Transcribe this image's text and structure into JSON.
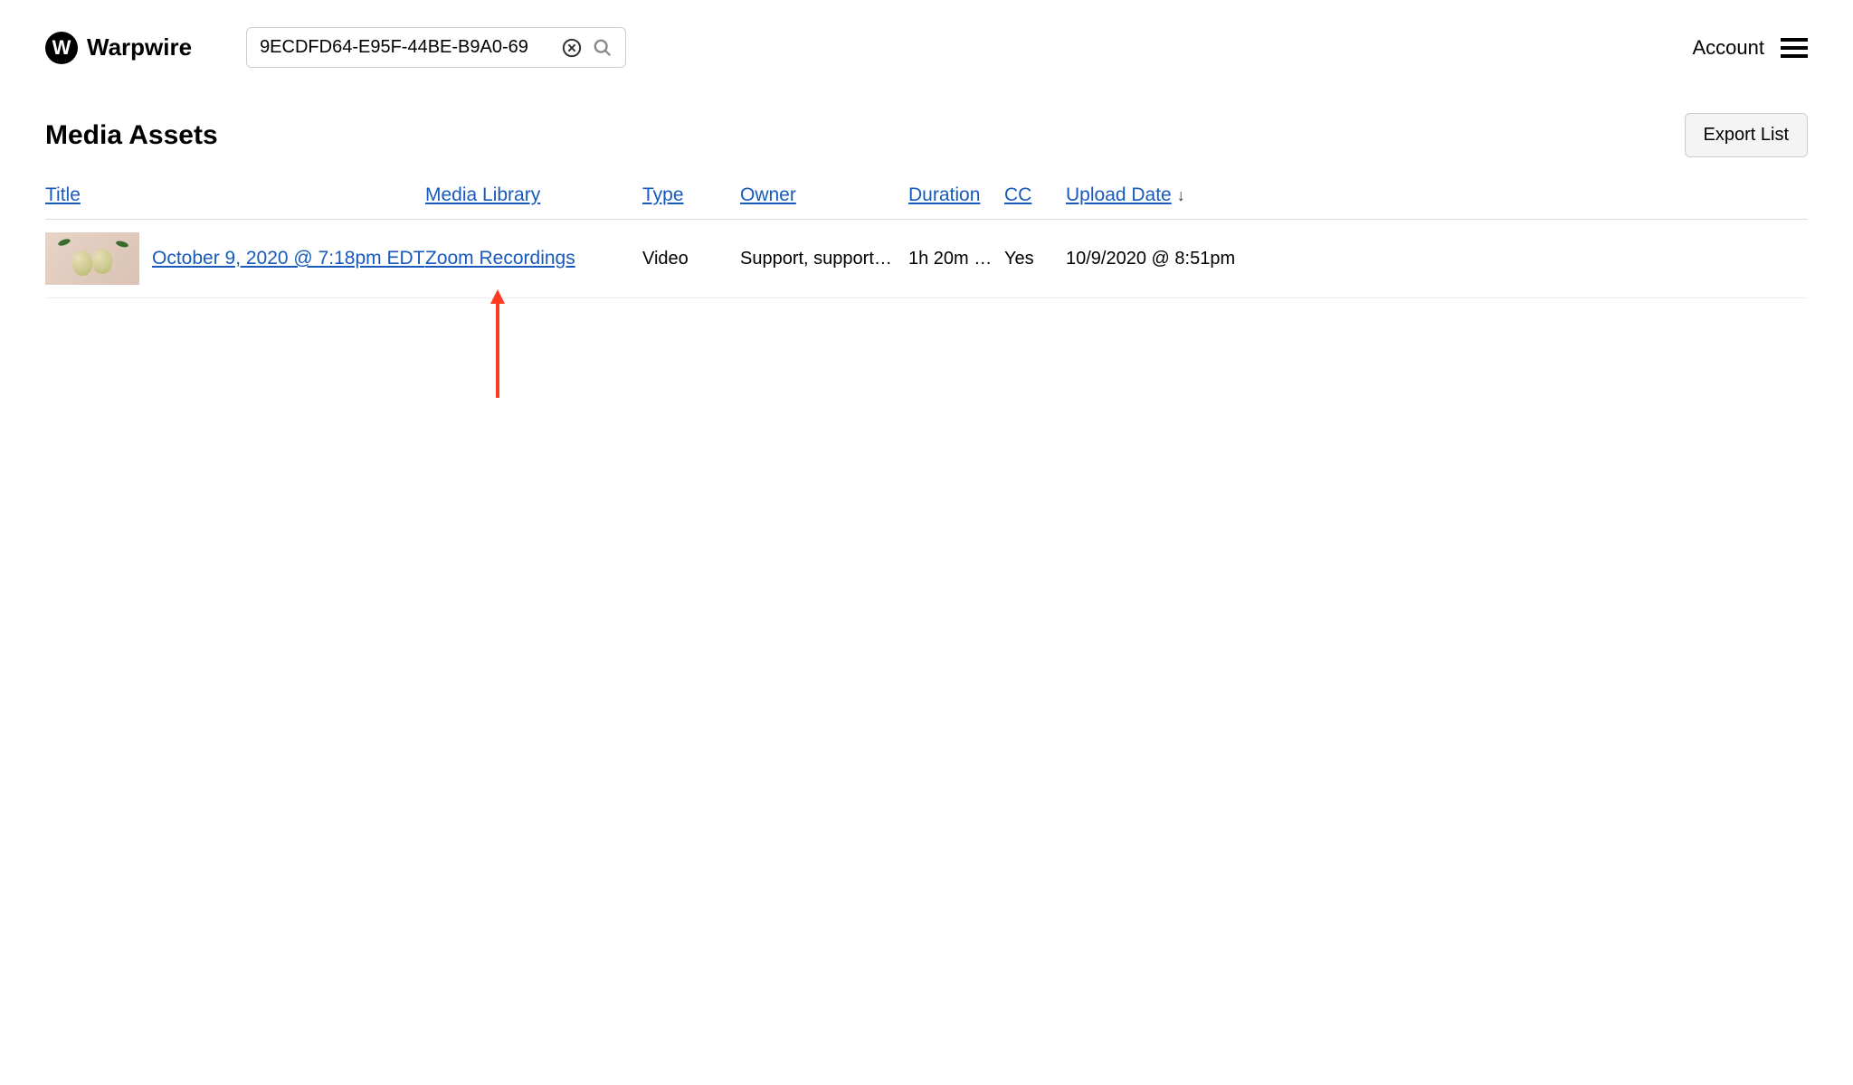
{
  "brand": {
    "name": "Warpwire",
    "logo_letter": "W"
  },
  "search": {
    "value": "9ECDFD64-E95F-44BE-B9A0-69"
  },
  "header": {
    "account_label": "Account"
  },
  "page": {
    "title": "Media Assets",
    "export_label": "Export List"
  },
  "columns": {
    "title": "Title",
    "media_library": "Media Library",
    "type": "Type",
    "owner": "Owner",
    "duration": "Duration",
    "cc": "CC",
    "upload_date": "Upload Date",
    "sort_indicator": "↓"
  },
  "rows": [
    {
      "title": "October 9, 2020 @ 7:18pm EDT",
      "media_library": "Zoom Recordings",
      "type": "Video",
      "owner": "Support, support@…",
      "duration": "1h 20m …",
      "cc": "Yes",
      "upload_date": "10/9/2020 @ 8:51pm"
    }
  ]
}
